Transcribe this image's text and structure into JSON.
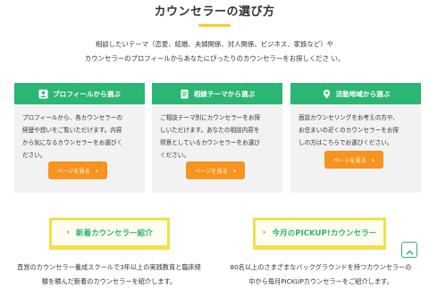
{
  "header": {
    "title": "カウンセラーの選び方",
    "accent_color": "#f2cf2e"
  },
  "intro": {
    "line1": "相談したいテーマ（恋愛、結婚、夫婦関係、対人関係、ビジネス、家族など）や",
    "line2": "カウンセラーのプロフィールからあなたにぴったりのカウンセラーをお探しくださ い。"
  },
  "cards": [
    {
      "header_label": "プロフィールから選ぶ",
      "icon": "profile-icon",
      "body_lines": [
        "プロフィールから、各カウンセラーの",
        "経歴や想いをご覧いただけます。内容",
        "から気になるカウンセラーをお選びく",
        "ださい。"
      ],
      "button_label": "ページを見る"
    },
    {
      "header_label": "相談テーマから選ぶ",
      "icon": "document-icon",
      "body_lines": [
        "ご相談テーマ別にカウンセラーをお探",
        "しいただけます。あなたの相談内容を",
        "得意としているカウンセラーをお選び",
        "ください。"
      ],
      "button_label": "ページを見る"
    },
    {
      "header_label": "活動地域から選ぶ",
      "icon": "map-pin-icon",
      "body_lines": [
        "面談カウンセリングをお考えの方や、",
        "お住まいの近くのカウンセラーをお探",
        "しの方はこちらでお選びください。"
      ],
      "button_label": "ページを見る"
    }
  ],
  "sections": [
    {
      "label": "新着カウンセラー紹介",
      "desc_lines": [
        "直営のカウンセラー養成スクールで3年以上の実践教育と臨床経",
        "験を積んだ新着のカウンセラーを紹介します。"
      ]
    },
    {
      "label": "今月のPICKUP!カウンセラー",
      "desc_lines": [
        "80名以上のさまざまなバックグラウンドを持つカウンセラーの",
        "中から毎月PICKUPカウンセラーをご紹介します。"
      ]
    }
  ],
  "colors": {
    "green": "#2bb673",
    "orange": "#f7931e",
    "yellow": "#f2e04a",
    "card_bg": "#f2f2f2"
  },
  "chevron_glyph": "›"
}
